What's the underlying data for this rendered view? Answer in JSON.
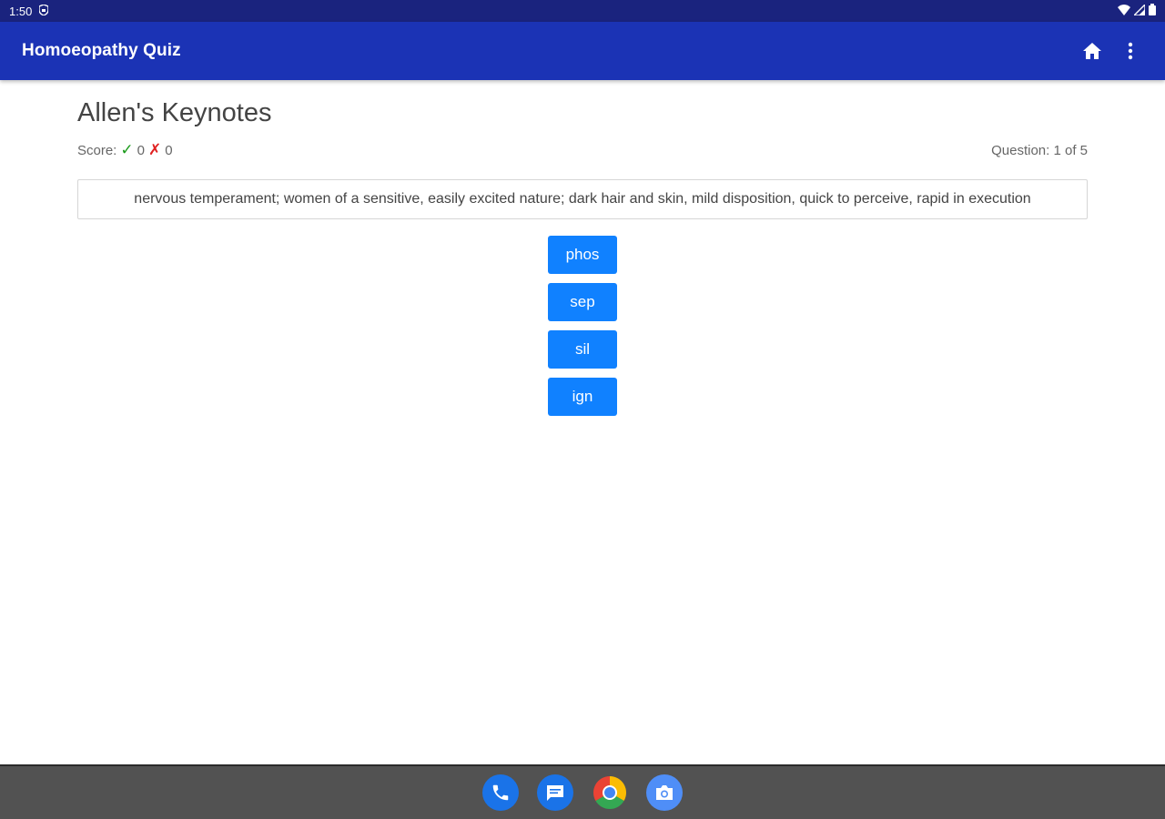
{
  "status_bar": {
    "time": "1:50",
    "icons": [
      "shield-icon",
      "wifi-icon",
      "signal-icon",
      "battery-icon"
    ]
  },
  "app_bar": {
    "title": "Homoeopathy Quiz",
    "icons": [
      "home-icon",
      "more-vert-icon"
    ]
  },
  "quiz": {
    "heading": "Allen's Keynotes",
    "score_label": "Score:",
    "correct_count": "0",
    "wrong_count": "0",
    "progress": "Question: 1 of 5",
    "question_text": "nervous temperament; women of a sensitive, easily excited nature; dark hair and skin, mild disposition, quick to perceive, rapid in execution",
    "answers": [
      "phos",
      "sep",
      "sil",
      "ign"
    ]
  },
  "dock": {
    "apps": [
      "phone-icon",
      "messages-icon",
      "chrome-icon",
      "camera-icon"
    ]
  },
  "colors": {
    "status_bar": "#1a237e",
    "app_bar": "#1b33b5",
    "answer_button": "#1081ff",
    "correct": "#1a9a1a",
    "wrong": "#e02020",
    "nav_bar": "#525252"
  }
}
